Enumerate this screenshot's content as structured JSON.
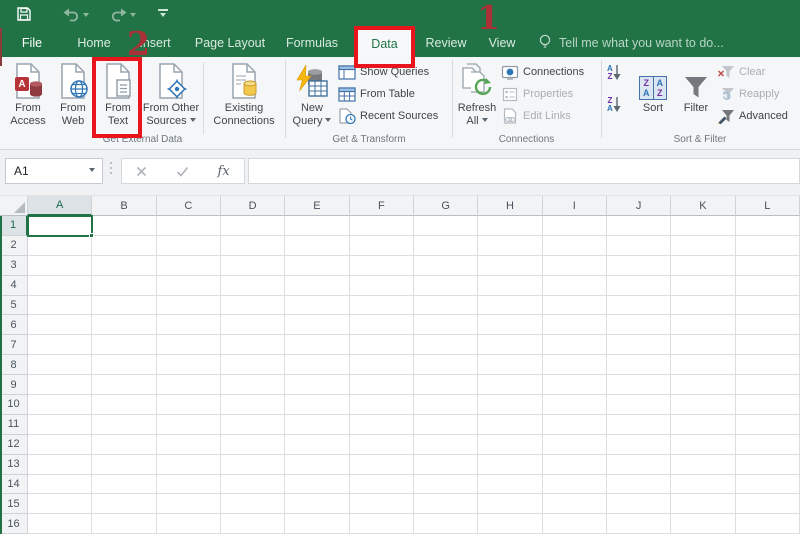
{
  "colors": {
    "accent_green": "#217346",
    "annotation_red": "#e8151d",
    "numeral_red": "#a93138",
    "sort_blue": "#2e75b6",
    "sort_purple": "#7030a0"
  },
  "tab_bar": {
    "tabs": [
      {
        "label": "File",
        "selected": false
      },
      {
        "label": "Home",
        "selected": false
      },
      {
        "label": "Insert",
        "selected": false
      },
      {
        "label": "Page Layout",
        "selected": false
      },
      {
        "label": "Formulas",
        "selected": false
      },
      {
        "label": "Data",
        "selected": true
      },
      {
        "label": "Review",
        "selected": false
      },
      {
        "label": "View",
        "selected": false
      }
    ],
    "tell_me": "Tell me what you want to do..."
  },
  "ribbon": {
    "get_external_data": {
      "label": "Get External Data",
      "from_access": "From Access",
      "from_web": "From Web",
      "from_text": "From Text",
      "from_other_sources": "From Other Sources",
      "existing_connections": "Existing Connections"
    },
    "get_transform": {
      "label": "Get & Transform",
      "new_query": "New Query",
      "show_queries": "Show Queries",
      "from_table": "From Table",
      "recent_sources": "Recent Sources"
    },
    "connections_group": {
      "label": "Connections",
      "refresh_all": "Refresh All",
      "connections": "Connections",
      "properties": "Properties",
      "edit_links": "Edit Links"
    },
    "sort_filter": {
      "label": "Sort & Filter",
      "sort": "Sort",
      "filter": "Filter",
      "clear": "Clear",
      "reapply": "Reapply",
      "advanced": "Advanced"
    }
  },
  "formula_bar": {
    "name_box": "A1",
    "fx": "fx",
    "formula": ""
  },
  "sheet": {
    "columns": [
      "A",
      "B",
      "C",
      "D",
      "E",
      "F",
      "G",
      "H",
      "I",
      "J",
      "K",
      "L"
    ],
    "rows": [
      "1",
      "2",
      "3",
      "4",
      "5",
      "6",
      "7",
      "8",
      "9",
      "10",
      "11",
      "12",
      "13",
      "14",
      "15",
      "16"
    ],
    "selected_cell": "A1"
  },
  "annotations": {
    "step_one": "1",
    "step_two": "2"
  },
  "icons": {
    "access_letter": "A",
    "letter_a": "A",
    "letter_z": "Z"
  }
}
